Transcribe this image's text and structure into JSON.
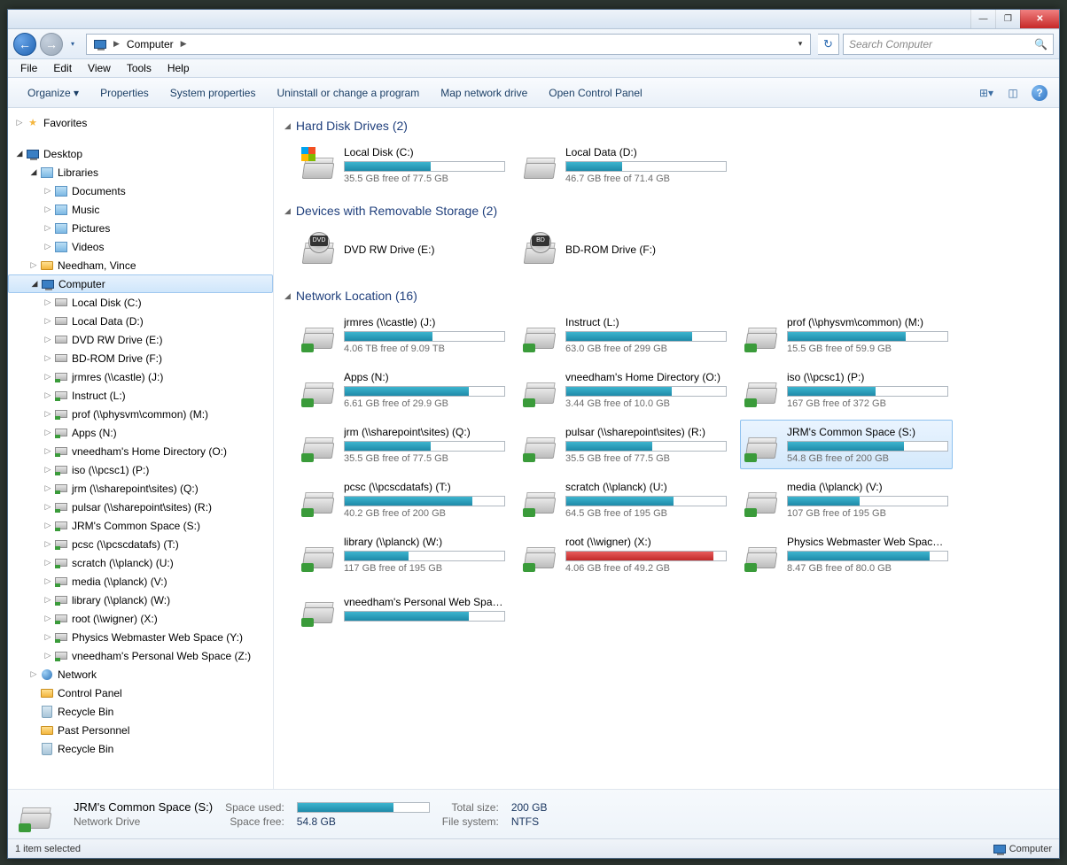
{
  "titlebar": {
    "min": "—",
    "max": "❐",
    "close": "✕"
  },
  "nav": {
    "back": "←",
    "forward": "→",
    "history_drop": "▾",
    "breadcrumb_computer": "Computer",
    "addr_drop": "▾",
    "refresh": "↻"
  },
  "search": {
    "placeholder": "Search Computer",
    "icon": "🔍"
  },
  "menubar": [
    "File",
    "Edit",
    "View",
    "Tools",
    "Help"
  ],
  "toolbar": {
    "organize": "Organize ▾",
    "items": [
      "Properties",
      "System properties",
      "Uninstall or change a program",
      "Map network drive",
      "Open Control Panel"
    ],
    "view_icon": "⊞▾",
    "preview_icon": "◫",
    "help": "?"
  },
  "tree": {
    "favorites": "Favorites",
    "desktop": "Desktop",
    "libraries": "Libraries",
    "lib_items": [
      "Documents",
      "Music",
      "Pictures",
      "Videos"
    ],
    "user": "Needham, Vince",
    "computer": "Computer",
    "drives": [
      "Local Disk (C:)",
      "Local Data (D:)",
      "DVD RW Drive (E:)",
      "BD-ROM Drive (F:)",
      "jrmres (\\\\castle) (J:)",
      "Instruct (L:)",
      "prof (\\\\physvm\\common) (M:)",
      "Apps (N:)",
      "vneedham's  Home Directory (O:)",
      "iso (\\\\pcsc1) (P:)",
      "jrm (\\\\sharepoint\\sites) (Q:)",
      "pulsar (\\\\sharepoint\\sites) (R:)",
      "JRM's Common Space (S:)",
      "pcsc (\\\\pcscdatafs) (T:)",
      "scratch (\\\\planck) (U:)",
      "media (\\\\planck) (V:)",
      "library (\\\\planck) (W:)",
      "root (\\\\wigner) (X:)",
      "Physics Webmaster Web Space (Y:)",
      "vneedham's  Personal Web Space (Z:)"
    ],
    "network": "Network",
    "control_panel": "Control Panel",
    "recycle1": "Recycle Bin",
    "past_personnel": "Past Personnel",
    "recycle2": "Recycle Bin"
  },
  "groups": {
    "hdd": {
      "title": "Hard Disk Drives (2)",
      "items": [
        {
          "name": "Local Disk (C:)",
          "sub": "35.5 GB free of 77.5 GB",
          "pct": 54,
          "red": false,
          "os": true
        },
        {
          "name": "Local Data (D:)",
          "sub": "46.7 GB free of 71.4 GB",
          "pct": 35,
          "red": false
        }
      ]
    },
    "rem": {
      "title": "Devices with Removable Storage (2)",
      "items": [
        {
          "name": "DVD RW Drive (E:)",
          "label": "DVD"
        },
        {
          "name": "BD-ROM Drive (F:)",
          "label": "BD"
        }
      ]
    },
    "net": {
      "title": "Network Location (16)",
      "items": [
        {
          "name": "jrmres (\\\\castle) (J:)",
          "sub": "4.06 TB free of 9.09 TB",
          "pct": 55
        },
        {
          "name": "Instruct (L:)",
          "sub": "63.0 GB free of 299 GB",
          "pct": 79
        },
        {
          "name": "prof (\\\\physvm\\common) (M:)",
          "sub": "15.5 GB free of 59.9 GB",
          "pct": 74
        },
        {
          "name": "Apps (N:)",
          "sub": "6.61 GB free of 29.9 GB",
          "pct": 78
        },
        {
          "name": "vneedham's  Home Directory (O:)",
          "sub": "3.44 GB free of 10.0 GB",
          "pct": 66
        },
        {
          "name": "iso (\\\\pcsc1) (P:)",
          "sub": "167 GB free of 372 GB",
          "pct": 55
        },
        {
          "name": "jrm (\\\\sharepoint\\sites) (Q:)",
          "sub": "35.5 GB free of 77.5 GB",
          "pct": 54
        },
        {
          "name": "pulsar (\\\\sharepoint\\sites) (R:)",
          "sub": "35.5 GB free of 77.5 GB",
          "pct": 54
        },
        {
          "name": "JRM's Common Space (S:)",
          "sub": "54.8 GB free of 200 GB",
          "pct": 73,
          "sel": true
        },
        {
          "name": "pcsc (\\\\pcscdatafs) (T:)",
          "sub": "40.2 GB free of 200 GB",
          "pct": 80
        },
        {
          "name": "scratch (\\\\planck) (U:)",
          "sub": "64.5 GB free of 195 GB",
          "pct": 67
        },
        {
          "name": "media (\\\\planck) (V:)",
          "sub": "107 GB free of 195 GB",
          "pct": 45
        },
        {
          "name": "library (\\\\planck) (W:)",
          "sub": "117 GB free of 195 GB",
          "pct": 40
        },
        {
          "name": "root (\\\\wigner) (X:)",
          "sub": "4.06 GB free of 49.2 GB",
          "pct": 92,
          "red": true
        },
        {
          "name": "Physics Webmaster Web Space (Y:)",
          "sub": "8.47 GB free of 80.0 GB",
          "pct": 89
        },
        {
          "name": "vneedham's  Personal Web Space (Z:)",
          "sub": "",
          "pct": 78
        }
      ]
    }
  },
  "details": {
    "title": "JRM's Common Space (S:)",
    "type": "Network Drive",
    "used_label": "Space used:",
    "free_label": "Space free:",
    "free_val": "54.8 GB",
    "total_label": "Total size:",
    "total_val": "200 GB",
    "fs_label": "File system:",
    "fs_val": "NTFS",
    "bar_pct": 73
  },
  "status": {
    "left": "1 item selected",
    "right": "Computer"
  }
}
